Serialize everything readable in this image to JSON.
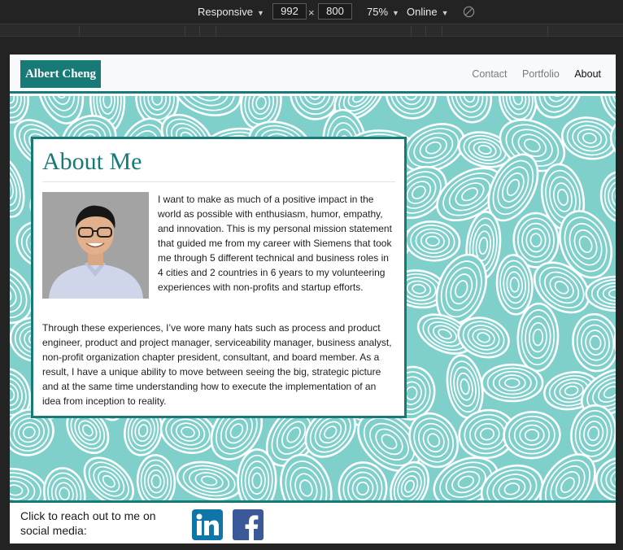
{
  "devtools": {
    "device": "Responsive",
    "width": "992",
    "height": "800",
    "zoom": "75%",
    "network": "Online",
    "icons": [
      "caret-down-icon",
      "rotate-icon"
    ]
  },
  "site": {
    "brand": "Albert Cheng",
    "nav": [
      "Contact",
      "Portfolio",
      "About"
    ],
    "active_nav": "About"
  },
  "about": {
    "title": "About Me",
    "paragraph1": "I want to make as much of a positive impact in the world as possible with enthusiasm, humor, empathy, and innovation. This is my personal mission statement that guided me from my career with Siemens that took me through 5 different technical and business roles in 4 cities and 2 countries in 6 years to my volunteering experiences with non-profits and startup efforts.",
    "paragraph2": "Through these experiences, I’ve wore many hats such as process and product engineer, product and project manager, serviceability manager, business analyst, non-profit organization chapter president, consultant, and board member. As a result, I have a unique ability to move between seeing the big, strategic picture and at the same time understanding how to execute the implementation of an idea from inception to reality."
  },
  "footer": {
    "text": "Click to reach out to me on social media:",
    "icons": [
      "linkedin-icon",
      "facebook-icon"
    ]
  },
  "colors": {
    "accent": "#177a76",
    "pattern_fill": "#7fcfcb",
    "pattern_line": "#ffffff"
  }
}
